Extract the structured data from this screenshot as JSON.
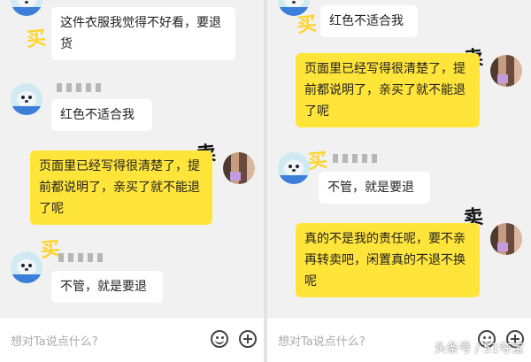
{
  "colors": {
    "buyer_bubble": "#ffffff",
    "seller_bubble": "#ffe43a",
    "mark_buy": "#ffd42a",
    "mark_sell": "#111111"
  },
  "labels": {
    "buy": "买",
    "sell": "卖"
  },
  "left_panel": {
    "messages": [
      "这件衣服我觉得不好看，要退货",
      "红色不适合我",
      "页面里已经写得很清楚了，提前都说明了，亲买了就不能退了呢",
      "不管，就是要退"
    ]
  },
  "right_panel": {
    "messages": [
      "红色不适合我",
      "页面里已经写得很清楚了，提前都说明了，亲买了就不能退了呢",
      "不管，就是要退",
      "真的不是我的责任呢，要不亲再转卖吧，闲置真的不退不换呢"
    ]
  },
  "input": {
    "placeholder": "想对Ta说点什么?"
  },
  "icons": {
    "emoji": "emoji-icon",
    "add": "plus-icon"
  },
  "watermark": "头条号 / 51夺宝"
}
